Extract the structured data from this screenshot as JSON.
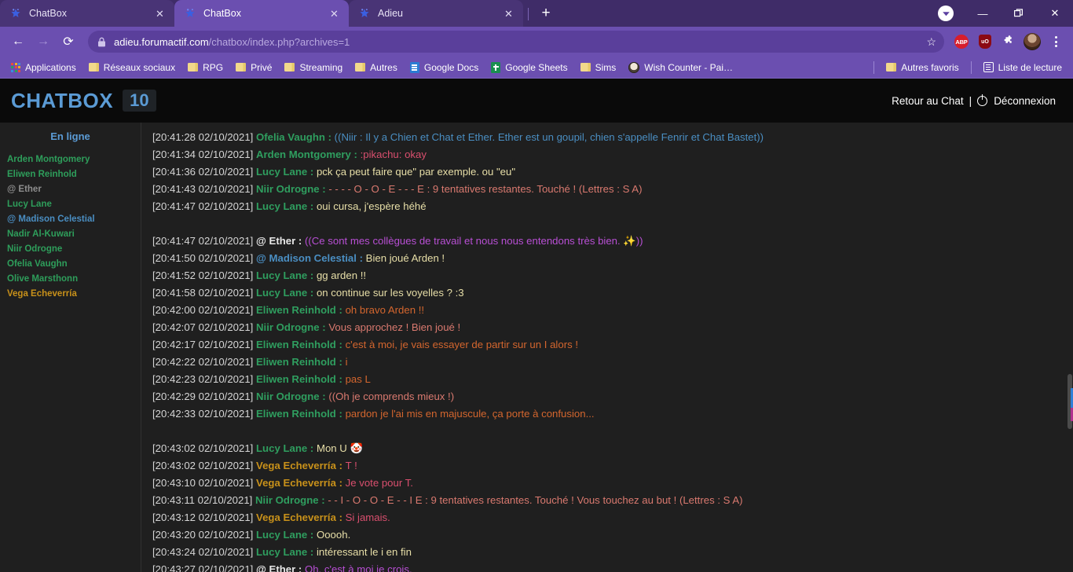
{
  "browser": {
    "tabs": [
      {
        "title": "ChatBox",
        "active": false,
        "favicon": "star-favicon",
        "close_label": "✕"
      },
      {
        "title": "ChatBox",
        "active": true,
        "favicon": "star-favicon",
        "close_label": "✕"
      },
      {
        "title": "Adieu",
        "active": false,
        "favicon": "star-favicon",
        "close_label": "✕"
      }
    ],
    "new_tab_label": "+",
    "window_controls": {
      "minimize": "—",
      "maximize": "❐",
      "close": "✕"
    },
    "nav": {
      "back": "←",
      "forward": "→",
      "reload": "⟳"
    },
    "omnibox": {
      "lock_icon": "lock-icon",
      "url_host": "adieu.forumactif.com",
      "url_path": "/chatbox/index.php?archives=1",
      "star_icon": "☆"
    },
    "extensions": [
      {
        "name": "adblock-plus-extension",
        "label": "ABP"
      },
      {
        "name": "ublock-origin-extension",
        "label": "uO"
      },
      {
        "name": "extensions-puzzle-icon",
        "label": "❖"
      }
    ],
    "menu_icon": "kebab-menu-icon",
    "bookmarks": [
      {
        "label": "Applications",
        "icon": "apps-grid-icon"
      },
      {
        "label": "Réseaux sociaux",
        "icon": "folder-icon"
      },
      {
        "label": "RPG",
        "icon": "folder-icon"
      },
      {
        "label": "Privé",
        "icon": "folder-icon"
      },
      {
        "label": "Streaming",
        "icon": "folder-icon"
      },
      {
        "label": "Autres",
        "icon": "folder-icon"
      },
      {
        "label": "Google Docs",
        "icon": "google-docs-icon"
      },
      {
        "label": "Google Sheets",
        "icon": "google-sheets-icon"
      },
      {
        "label": "Sims",
        "icon": "folder-icon"
      },
      {
        "label": "Wish Counter - Pai…",
        "icon": "wish-counter-icon"
      }
    ],
    "bookmarks_right": [
      {
        "label": "Autres favoris",
        "icon": "folder-icon"
      },
      {
        "label": "Liste de lecture",
        "icon": "reading-list-icon"
      }
    ]
  },
  "chatbox": {
    "title": "CHATBOX",
    "badge": "10",
    "back_to_chat": "Retour au Chat",
    "separator": "|",
    "logout": "Déconnexion",
    "online": {
      "heading": "En ligne",
      "users": [
        {
          "name": "Arden Montgomery",
          "color": "#2e9e5b"
        },
        {
          "name": "Eliwen Reinhold",
          "color": "#2e9e5b"
        },
        {
          "name": "@ Ether",
          "color": "#8e8e8e"
        },
        {
          "name": "Lucy Lane",
          "color": "#2e9e5b"
        },
        {
          "name": "@ Madison Celestial",
          "color": "#4a8ec2"
        },
        {
          "name": "Nadir Al-Kuwari",
          "color": "#2e9e5b"
        },
        {
          "name": "Niir Odrogne",
          "color": "#2e9e5b"
        },
        {
          "name": "Ofelia Vaughn",
          "color": "#2e9e5b"
        },
        {
          "name": "Olive Marsthonn",
          "color": "#2e9e5b"
        },
        {
          "name": "Vega Echeverría",
          "color": "#c8911a"
        }
      ]
    },
    "messages": [
      {
        "timestamp": "[20:41:28 02/10/2021]",
        "author": "Ofelia Vaughn",
        "author_color": "#2f9e5f",
        "sep": " : ",
        "text": "((Niir : Il y a Chien et Chat et Ether. Ether est un goupil, chien s'appelle Fenrir et Chat Bastet))",
        "text_color": "#4a8ec2",
        "spacer_before": false
      },
      {
        "timestamp": "[20:41:34 02/10/2021]",
        "author": "Arden Montgomery",
        "author_color": "#2f9e5f",
        "sep": " : ",
        "text": ":pikachu: okay",
        "text_color": "#d94f6e",
        "spacer_before": false
      },
      {
        "timestamp": "[20:41:36 02/10/2021]",
        "author": "Lucy Lane",
        "author_color": "#2f9e5f",
        "sep": " : ",
        "text": "pck ça peut faire que\" par exemple. ou \"eu\"",
        "text_color": "#e8dfa8",
        "spacer_before": false
      },
      {
        "timestamp": "[20:41:43 02/10/2021]",
        "author": "Niir Odrogne",
        "author_color": "#2f9e5f",
        "sep": " : ",
        "text": "- - - - O - O - E - - - E : 9 tentatives restantes. Touché ! (Lettres : S A)",
        "text_color": "#d9796f",
        "spacer_before": false
      },
      {
        "timestamp": "[20:41:47 02/10/2021]",
        "author": "Lucy Lane",
        "author_color": "#2f9e5f",
        "sep": " : ",
        "text": "oui cursa, j'espère héhé",
        "text_color": "#e8dfa8",
        "spacer_before": false
      },
      {
        "timestamp": "[20:41:47 02/10/2021]",
        "author": "@ Ether",
        "author_color": "#e8e8e8",
        "sep": " : ",
        "text": "((Ce sont mes collègues de travail et nous nous entendons très bien. ✨))",
        "text_color": "#b84fd4",
        "spacer_before": true
      },
      {
        "timestamp": "[20:41:50 02/10/2021]",
        "author": "@ Madison Celestial",
        "author_color": "#4a8ec2",
        "sep": " : ",
        "text": "Bien joué Arden !",
        "text_color": "#e8dfa8",
        "spacer_before": false
      },
      {
        "timestamp": "[20:41:52 02/10/2021]",
        "author": "Lucy Lane",
        "author_color": "#2f9e5f",
        "sep": " : ",
        "text": "gg arden !!",
        "text_color": "#e8dfa8",
        "spacer_before": false
      },
      {
        "timestamp": "[20:41:58 02/10/2021]",
        "author": "Lucy Lane",
        "author_color": "#2f9e5f",
        "sep": " : ",
        "text": "on continue sur les voyelles ? :3",
        "text_color": "#e8dfa8",
        "spacer_before": false
      },
      {
        "timestamp": "[20:42:00 02/10/2021]",
        "author": "Eliwen Reinhold",
        "author_color": "#2f9e5f",
        "sep": " : ",
        "text": "oh bravo Arden !!",
        "text_color": "#d4662e",
        "spacer_before": false
      },
      {
        "timestamp": "[20:42:07 02/10/2021]",
        "author": "Niir Odrogne",
        "author_color": "#2f9e5f",
        "sep": " : ",
        "text": "Vous approchez ! Bien joué !",
        "text_color": "#d9796f",
        "spacer_before": false
      },
      {
        "timestamp": "[20:42:17 02/10/2021]",
        "author": "Eliwen Reinhold",
        "author_color": "#2f9e5f",
        "sep": " : ",
        "text": "c'est à moi, je vais essayer de partir sur un I alors !",
        "text_color": "#d4662e",
        "spacer_before": false
      },
      {
        "timestamp": "[20:42:22 02/10/2021]",
        "author": "Eliwen Reinhold",
        "author_color": "#2f9e5f",
        "sep": " : ",
        "text": "i",
        "text_color": "#d4662e",
        "spacer_before": false
      },
      {
        "timestamp": "[20:42:23 02/10/2021]",
        "author": "Eliwen Reinhold",
        "author_color": "#2f9e5f",
        "sep": " : ",
        "text": "pas L",
        "text_color": "#d4662e",
        "spacer_before": false
      },
      {
        "timestamp": "[20:42:29 02/10/2021]",
        "author": "Niir Odrogne",
        "author_color": "#2f9e5f",
        "sep": " : ",
        "text": "((Oh je comprends mieux !)",
        "text_color": "#d9796f",
        "spacer_before": false
      },
      {
        "timestamp": "[20:42:33 02/10/2021]",
        "author": "Eliwen Reinhold",
        "author_color": "#2f9e5f",
        "sep": " : ",
        "text": "pardon je l'ai mis en majuscule, ça porte à confusion...",
        "text_color": "#d4662e",
        "spacer_before": false
      },
      {
        "timestamp": "[20:43:02 02/10/2021]",
        "author": "Lucy Lane",
        "author_color": "#2f9e5f",
        "sep": " : ",
        "text": "Mon U 🤡",
        "text_color": "#e8dfa8",
        "spacer_before": true
      },
      {
        "timestamp": "[20:43:02 02/10/2021]",
        "author": "Vega Echeverría",
        "author_color": "#c8911a",
        "sep": " : ",
        "text": "T !",
        "text_color": "#d94f6e",
        "spacer_before": false
      },
      {
        "timestamp": "[20:43:10 02/10/2021]",
        "author": "Vega Echeverría",
        "author_color": "#c8911a",
        "sep": " : ",
        "text": "Je vote pour T.",
        "text_color": "#d94f6e",
        "spacer_before": false
      },
      {
        "timestamp": "[20:43:11 02/10/2021]",
        "author": "Niir Odrogne",
        "author_color": "#2f9e5f",
        "sep": " : ",
        "text": "- - I - O - O - E - - I E : 9 tentatives restantes. Touché ! Vous touchez au but ! (Lettres : S A)",
        "text_color": "#d9796f",
        "spacer_before": false
      },
      {
        "timestamp": "[20:43:12 02/10/2021]",
        "author": "Vega Echeverría",
        "author_color": "#c8911a",
        "sep": " : ",
        "text": "Si jamais.",
        "text_color": "#d94f6e",
        "spacer_before": false
      },
      {
        "timestamp": "[20:43:20 02/10/2021]",
        "author": "Lucy Lane",
        "author_color": "#2f9e5f",
        "sep": " : ",
        "text": "Ooooh.",
        "text_color": "#e8dfa8",
        "spacer_before": false
      },
      {
        "timestamp": "[20:43:24 02/10/2021]",
        "author": "Lucy Lane",
        "author_color": "#2f9e5f",
        "sep": " : ",
        "text": "intéressant le i en fin",
        "text_color": "#e8dfa8",
        "spacer_before": false
      },
      {
        "timestamp": "[20:43:27 02/10/2021]",
        "author": "@ Ether",
        "author_color": "#e8e8e8",
        "sep": " : ",
        "text": "Oh, c'est à moi je crois.",
        "text_color": "#b84fd4",
        "spacer_before": false
      }
    ]
  }
}
